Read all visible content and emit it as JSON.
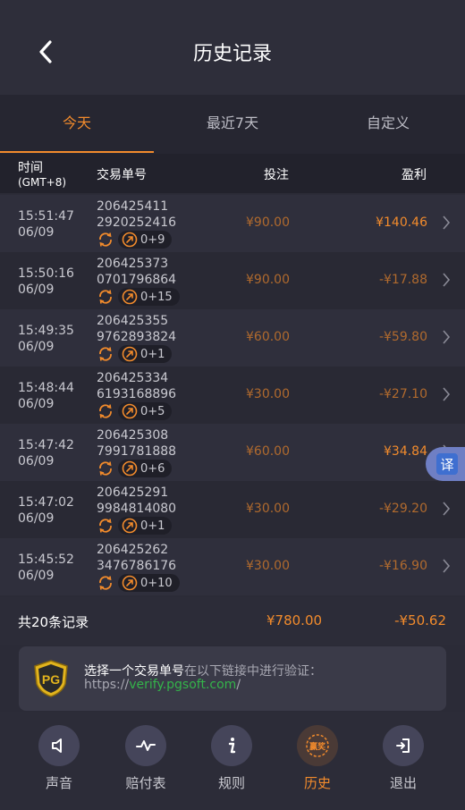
{
  "header": {
    "title": "历史记录"
  },
  "tabs": [
    {
      "label": "今天",
      "active": true
    },
    {
      "label": "最近7天",
      "active": false
    },
    {
      "label": "自定义",
      "active": false
    }
  ],
  "columns": {
    "time": "时间",
    "timezone": "(GMT+8)",
    "txid": "交易单号",
    "bet": "投注",
    "profit": "盈利"
  },
  "rows": [
    {
      "time": "15:51:47",
      "date": "06/09",
      "txid_1": "206425411",
      "txid_2": "2920252416",
      "free": "0+9",
      "bet": "¥90.00",
      "profit": "¥140.46",
      "profit_type": "win"
    },
    {
      "time": "15:50:16",
      "date": "06/09",
      "txid_1": "206425373",
      "txid_2": "0701796864",
      "free": "0+15",
      "bet": "¥90.00",
      "profit": "-¥17.88",
      "profit_type": "loss"
    },
    {
      "time": "15:49:35",
      "date": "06/09",
      "txid_1": "206425355",
      "txid_2": "9762893824",
      "free": "0+1",
      "bet": "¥60.00",
      "profit": "-¥59.80",
      "profit_type": "loss"
    },
    {
      "time": "15:48:44",
      "date": "06/09",
      "txid_1": "206425334",
      "txid_2": "6193168896",
      "free": "0+5",
      "bet": "¥30.00",
      "profit": "-¥27.10",
      "profit_type": "loss"
    },
    {
      "time": "15:47:42",
      "date": "06/09",
      "txid_1": "206425308",
      "txid_2": "7991781888",
      "free": "0+6",
      "bet": "¥60.00",
      "profit": "¥34.84",
      "profit_type": "win"
    },
    {
      "time": "15:47:02",
      "date": "06/09",
      "txid_1": "206425291",
      "txid_2": "9984814080",
      "free": "0+1",
      "bet": "¥30.00",
      "profit": "-¥29.20",
      "profit_type": "loss"
    },
    {
      "time": "15:45:52",
      "date": "06/09",
      "txid_1": "206425262",
      "txid_2": "3476786176",
      "free": "0+10",
      "bet": "¥30.00",
      "profit": "-¥16.90",
      "profit_type": "loss"
    }
  ],
  "summary": {
    "label": "共20条记录",
    "total_bet": "¥780.00",
    "total_profit": "-¥50.62"
  },
  "verify": {
    "strong": "选择一个交易单号",
    "rest": "在以下链接中进行验证：",
    "prefix": "https://",
    "link": "verify.pgsoft.com",
    "suffix": "/",
    "logo_text": "PG"
  },
  "translate": {
    "label": "译"
  },
  "nav": [
    {
      "label": "声音",
      "icon": "speaker-icon",
      "active": false
    },
    {
      "label": "赔付表",
      "icon": "pulse-icon",
      "active": false
    },
    {
      "label": "规则",
      "icon": "info-icon",
      "active": false
    },
    {
      "label": "历史",
      "icon": "history-badge-icon",
      "active": true,
      "badge_text": "赢奖"
    },
    {
      "label": "退出",
      "icon": "exit-icon",
      "active": false
    }
  ],
  "colors": {
    "accent": "#f28b2c",
    "loss": "#b06a2e",
    "link": "#34b34a"
  }
}
